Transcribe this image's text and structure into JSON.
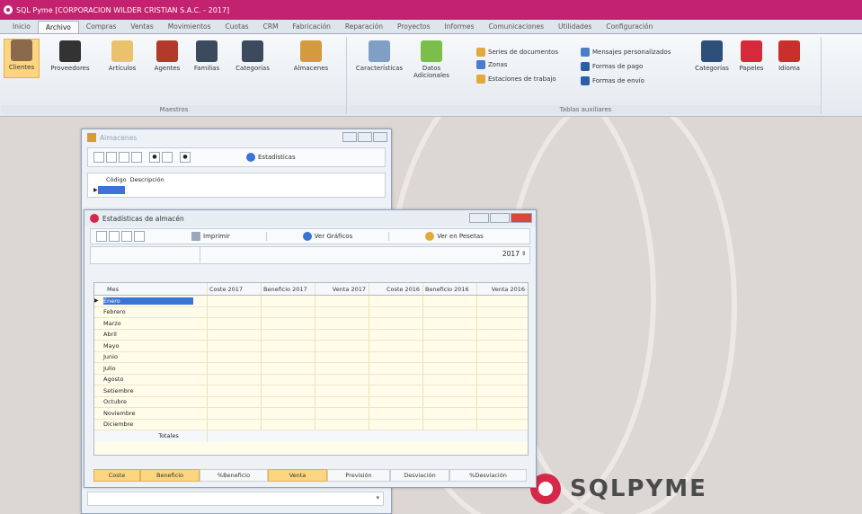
{
  "title": "SQL Pyme [CORPORACION WILDER CRISTIAN S.A.C. - 2017]",
  "menu": [
    "Inicio",
    "Archivo",
    "Compras",
    "Ventas",
    "Movimientos",
    "Cuotas",
    "CRM",
    "Fabricación",
    "Reparación",
    "Proyectos",
    "Informes",
    "Comunicaciones",
    "Utilidades",
    "Configuración"
  ],
  "ribbon": {
    "maestros": {
      "label": "Maestros",
      "buttons": [
        "Clientes",
        "Proveedores",
        "Artículos",
        "Agentes",
        "Familias",
        "Categorías",
        "Almacenes"
      ]
    },
    "tablas": {
      "label": "Tablas auxiliares",
      "caracteristicas": "Características",
      "datos": [
        "Datos",
        "Adicionales"
      ],
      "small": [
        "Series de documentos",
        "Zonas",
        "Estaciones de trabajo",
        "Mensajes personalizados",
        "Formas de pago",
        "Formas de envío"
      ],
      "right": [
        "Categorías",
        "Papeles",
        "Idioma"
      ]
    }
  },
  "almacenes": {
    "title": "Almacenes",
    "estadisticas": "Estadísticas",
    "col_codigo": "Código",
    "col_desc": "Descripción"
  },
  "stats": {
    "title": "Estadísticas de almacén",
    "imprimir": "Imprimir",
    "ver_graficos": "Ver Gráficos",
    "ver_pesetas": "Ver en Pesetas",
    "year": "2017",
    "columns": [
      "Mes",
      "Coste 2017",
      "Beneficio 2017",
      "Venta 2017",
      "Coste 2016",
      "Beneficio 2016",
      "Venta 2016"
    ],
    "months": [
      "Enero",
      "Febrero",
      "Marzo",
      "Abril",
      "Mayo",
      "Junio",
      "Julio",
      "Agosto",
      "Setiembre",
      "Octubre",
      "Noviembre",
      "Diciembre"
    ],
    "totales": "Totales",
    "bottom": [
      "Coste",
      "Beneficio",
      "%Beneficio",
      "Venta",
      "Previsión",
      "Desviación",
      "%Desviación"
    ]
  },
  "brand": "SQLPYME",
  "colors": {
    "titlebar": "#c2226f",
    "highlight": "#fbd580",
    "grid": "#fffce9"
  }
}
